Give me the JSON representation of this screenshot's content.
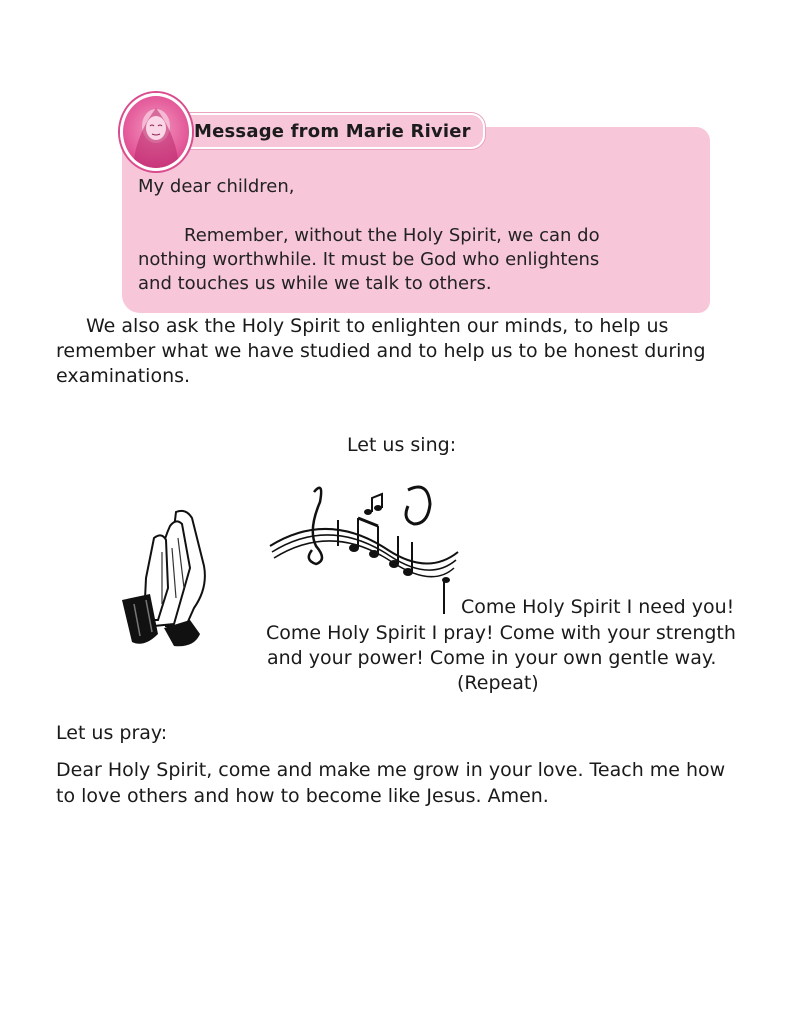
{
  "message": {
    "title": "Message from Marie Rivier",
    "greeting": "My dear children,",
    "lines": [
      "Remember, without the Holy Spirit, we can do",
      "nothing worthwhile. It must be God who enlightens",
      "and touches us while we talk to others."
    ]
  },
  "paragraph1": {
    "lines": [
      "We also ask the Holy Spirit to enlighten our minds, to help us",
      "remember what we have studied and to help us to be honest during",
      "examinations."
    ]
  },
  "sing": {
    "label": "Let us sing:",
    "lines": [
      "Come Holy Spirit I need you!",
      "Come Holy Spirit I pray! Come with your strength",
      "and your power! Come in your own gentle way.",
      "(Repeat)"
    ]
  },
  "pray": {
    "label": "Let us pray:",
    "lines": [
      "Dear Holy Spirit, come and make me grow in your love. Teach me how",
      "to love others and how to become like Jesus. Amen."
    ]
  },
  "colors": {
    "box": "#f7c6d8",
    "avatar": "#e45a9a"
  },
  "icons": [
    "portrait-avatar-icon",
    "praying-hands-icon",
    "music-notes-icon"
  ]
}
